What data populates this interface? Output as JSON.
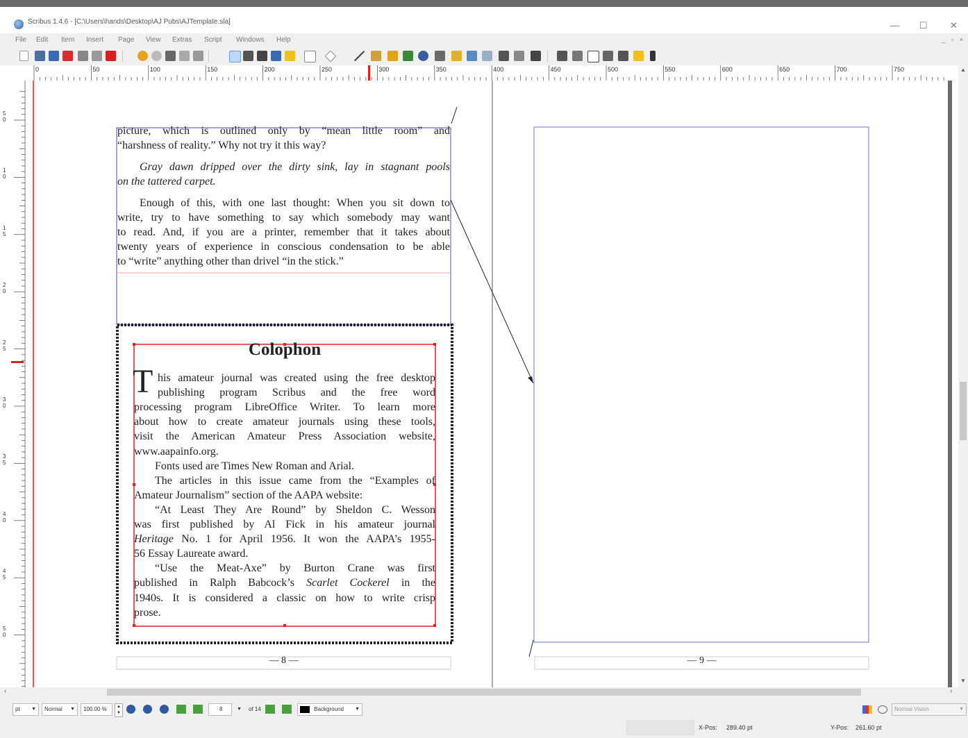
{
  "window": {
    "title": "Scribus 1.4.6 - [C:\\Users\\hands\\Desktop\\AJ Pubs\\AJTemplate.sla]",
    "minimize": "—",
    "maximize": "☐",
    "close": "✕"
  },
  "menu": [
    "File",
    "Edit",
    "Item",
    "Insert",
    "Page",
    "View",
    "Extras",
    "Script",
    "Windows",
    "Help"
  ],
  "mdi_buttons": "_ ▫ ×",
  "ruler_h": [
    "0",
    "50",
    "100",
    "150",
    "200",
    "250",
    "300",
    "350",
    "400",
    "450",
    "500",
    "550",
    "600",
    "650",
    "700",
    "750"
  ],
  "ruler_v": [
    "5\n0",
    "1\n0",
    "1\n5",
    "2\n0",
    "2\n5",
    "3\n0",
    "3\n5",
    "4\n0",
    "4\n5",
    "5\n0"
  ],
  "page_left": {
    "body_lines": [
      {
        "text": "picture, which is outlined only by “mean little room” and",
        "justify": true,
        "italic": false
      },
      {
        "text": "“harshness of reality.” Why not try it this way?",
        "justify": false,
        "italic": false
      },
      {
        "text": "Gray dawn dripped over the dirty sink, lay in stagnant pools",
        "justify": true,
        "italic": true,
        "indent": true
      },
      {
        "text": "on the tattered carpet.",
        "justify": false,
        "italic": true
      },
      {
        "text": "Enough of this, with one last thought: When you sit down to",
        "justify": true,
        "italic": false,
        "indent": true
      },
      {
        "text": "write, try to have something to say which somebody may want",
        "justify": true,
        "italic": false
      },
      {
        "text": "to read. And, if you are a printer, remember that it takes about",
        "justify": true,
        "italic": false
      },
      {
        "text": "twenty years of experience in conscious condensation to be able",
        "justify": true,
        "italic": false
      },
      {
        "text": "to “write” anything other than drivel “in the stick.”",
        "justify": false,
        "italic": false
      }
    ],
    "colophon": {
      "heading": "Colophon",
      "dropcap": "T",
      "lines": [
        {
          "text": "his amateur journal was created using the free desktop",
          "justify": true,
          "cap": true
        },
        {
          "text": "publishing program Scribus and the free word",
          "justify": true,
          "cap": true
        },
        {
          "text": "processing program LibreOffice Writer. To learn more",
          "justify": true
        },
        {
          "text": "about how to create amateur journals using these tools,",
          "justify": true
        },
        {
          "text": "visit the American Amateur Press Association website,",
          "justify": true
        },
        {
          "text": "www.aapainfo.org.",
          "justify": false
        },
        {
          "text": "Fonts used are Times New Roman and Arial.",
          "justify": false,
          "indent": true
        },
        {
          "text": "The articles in this issue came from the “Examples of",
          "justify": true,
          "indent": true
        },
        {
          "text": "Amateur Journalism” section of the AAPA website:",
          "justify": false
        },
        {
          "text": "“At Least They Are Round” by Sheldon C. Wesson",
          "justify": true,
          "indent": true
        },
        {
          "text": "was first published by Al Fick in his amateur journal",
          "justify": true
        },
        {
          "text": "Heritage No. 1 for April 1956. It won the AAPA’s 1955-",
          "justify": true,
          "lead_italic": "Heritage"
        },
        {
          "text": "56 Essay Laureate award.",
          "justify": false
        },
        {
          "text": "“Use the Meat-Axe” by Burton Crane was first",
          "justify": true,
          "indent": true
        },
        {
          "text": "published in Ralph Babcock’s Scarlet Cockerel in the",
          "justify": true
        },
        {
          "text": "1940s. It is considered a classic on how to write crisp",
          "justify": true
        },
        {
          "text": "prose.",
          "justify": false
        }
      ]
    },
    "page_number": "— 8 —"
  },
  "page_right": {
    "page_number": "— 9 —"
  },
  "statusbar": {
    "unit": "pt",
    "mode": "Normal",
    "zoom": "100.00 %",
    "page_current": "8",
    "page_total": "of 14",
    "layer": "Background",
    "vision": "Normal Vision",
    "xpos_label": "X-Pos:",
    "xpos_value": "289.40 pt",
    "ypos_label": "Y-Pos:",
    "ypos_value": "261.60 pt"
  },
  "colors": {
    "frame_blue": "#4a4ad8",
    "selection_red": "#e02020",
    "guide_pink": "#f0a0a8",
    "ruler_marker": "#e02020"
  }
}
